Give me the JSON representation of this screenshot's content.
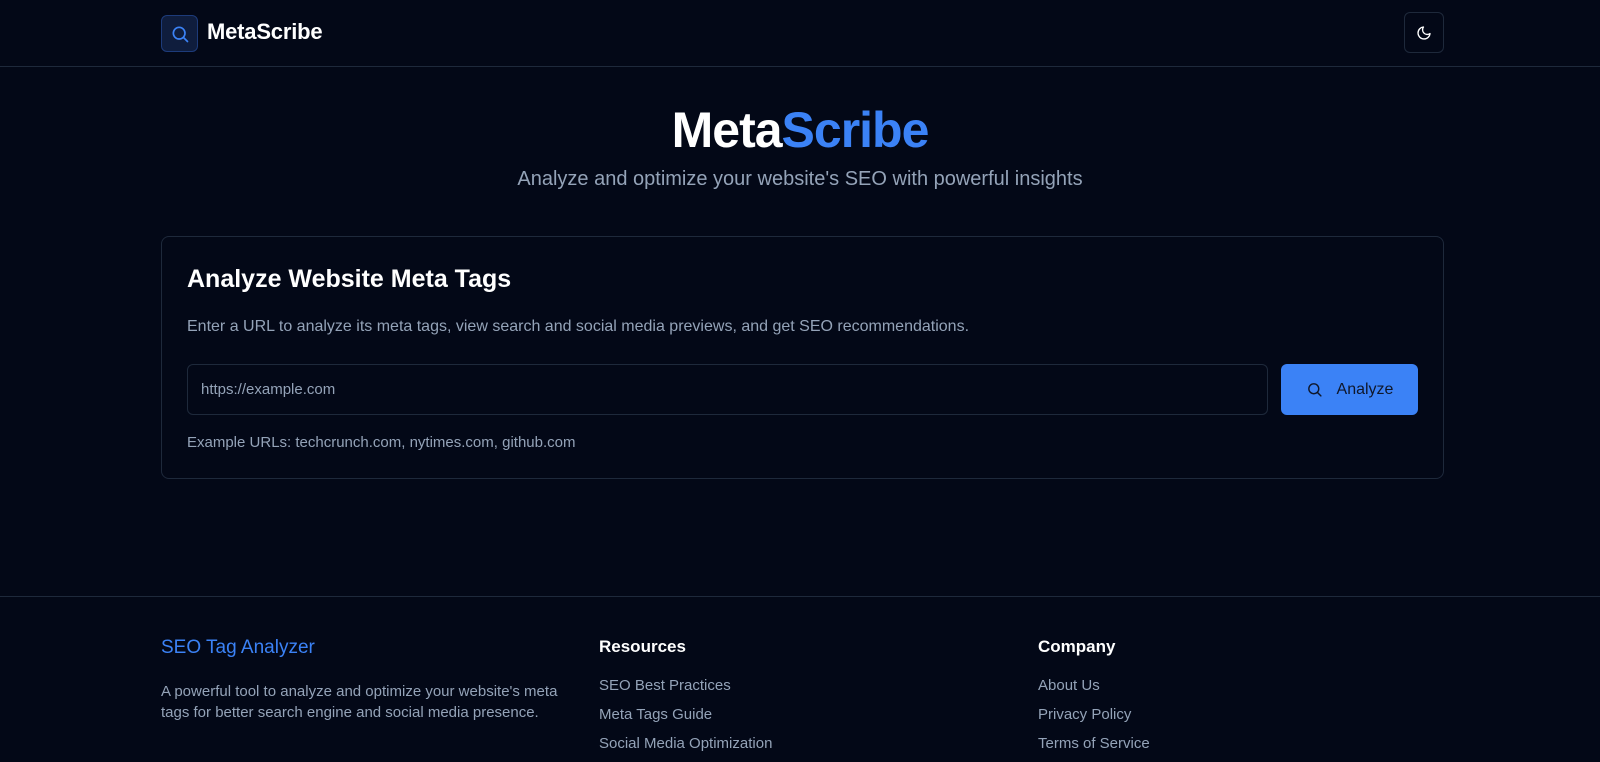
{
  "header": {
    "brand": "MetaScribe",
    "logo_icon": "search-icon",
    "theme_toggle_icon": "moon-icon"
  },
  "hero": {
    "title_part1": "Meta",
    "title_part2": "Scribe",
    "subtitle": "Analyze and optimize your website's SEO with powerful insights"
  },
  "analyzer": {
    "title": "Analyze Website Meta Tags",
    "description": "Enter a URL to analyze its meta tags, view search and social media previews, and get SEO recommendations.",
    "input_placeholder": "https://example.com",
    "button_label": "Analyze",
    "examples": "Example URLs: techcrunch.com, nytimes.com, github.com"
  },
  "footer": {
    "brand_title": "SEO Tag Analyzer",
    "brand_desc": "A powerful tool to analyze and optimize your website's meta tags for better search engine and social media presence.",
    "resources": {
      "heading": "Resources",
      "links": [
        "SEO Best Practices",
        "Meta Tags Guide",
        "Social Media Optimization"
      ]
    },
    "company": {
      "heading": "Company",
      "links": [
        "About Us",
        "Privacy Policy",
        "Terms of Service"
      ]
    }
  },
  "colors": {
    "background": "#030817",
    "accent": "#3b82f6",
    "muted_text": "#94a3b8",
    "border": "#1e293b"
  }
}
